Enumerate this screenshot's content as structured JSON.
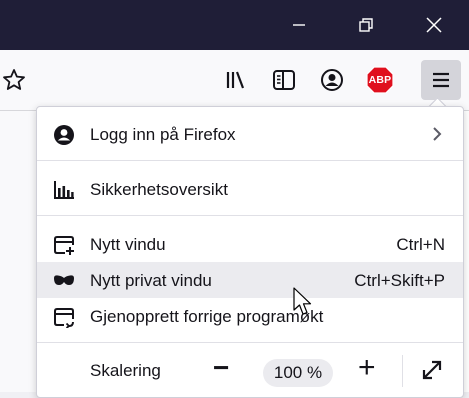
{
  "window": {
    "minimize_icon": "minimize-icon",
    "restore_icon": "restore-icon",
    "close_icon": "close-icon"
  },
  "toolbar": {
    "bookmark_icon": "star-icon",
    "library_icon": "library-icon",
    "sidebar_icon": "sidebar-icon",
    "account_icon": "account-icon",
    "abp_label": "ABP",
    "menu_icon": "hamburger-icon"
  },
  "menu": {
    "sign_in": "Logg inn på Firefox",
    "security": "Sikkerhetsoversikt",
    "new_window": "Nytt vindu",
    "new_window_shortcut": "Ctrl+N",
    "private_window": "Nytt privat vindu",
    "private_window_shortcut": "Ctrl+Skift+P",
    "restore_session": "Gjenopprett forrige programøkt",
    "zoom_label": "Skalering",
    "zoom_out": "−",
    "zoom_value": "100 %",
    "zoom_in": "+"
  },
  "colors": {
    "titlebar": "#1f1e37",
    "abp_red": "#e0101e",
    "hover_row": "#ebebef"
  }
}
